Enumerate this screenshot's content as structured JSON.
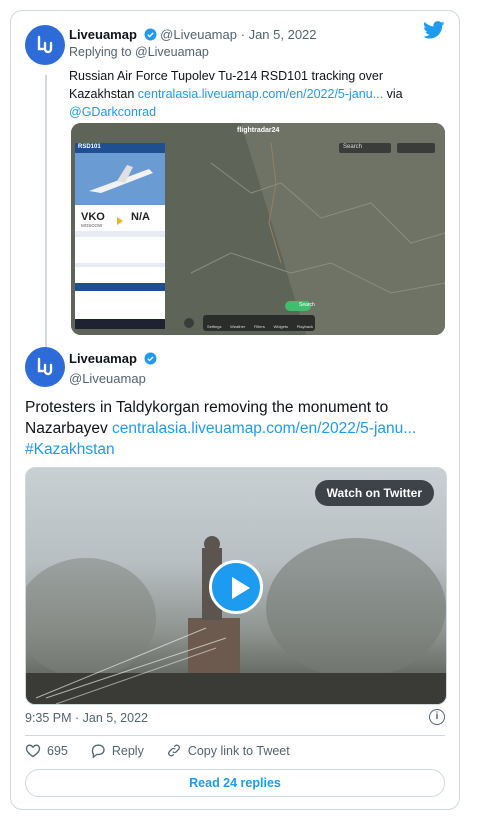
{
  "quoted": {
    "name": "Liveuamap",
    "handle": "@Liveuamap",
    "date": "Jan 5, 2022",
    "separator": "·",
    "replying_prefix": "Replying to ",
    "replying_handle": "@Liveuamap",
    "text_1": "Russian Air Force Tupolev Tu-214 RSD101 tracking over Kazakhstan ",
    "link": "centralasia.liveuamap.com/en/2022/5-janu...",
    "text_2": " via ",
    "mention": "@GDarkconrad",
    "map": {
      "brand": "flightradar24",
      "flight": "RSD101",
      "origin": "VKO",
      "destination": "N/A",
      "origin_city": "MOSCOW",
      "search": "Search",
      "action_label": "Search",
      "tabs": [
        "Settings",
        "Weather",
        "Filters",
        "Widgets",
        "Playback"
      ]
    }
  },
  "tweet": {
    "name": "Liveuamap",
    "handle": "@Liveuamap",
    "text": "Protesters in Taldykorgan removing the monument to Nazarbayev ",
    "link": "centralasia.liveuamap.com/en/2022/5-janu...",
    "hashtag": "#Kazakhstan",
    "video_button": "Watch on Twitter",
    "timestamp": "9:35 PM · Jan 5, 2022",
    "likes": "695",
    "reply_label": "Reply",
    "copy_label": "Copy link to Tweet",
    "read_replies": "Read 24 replies"
  },
  "colors": {
    "accent": "#1d9bf0",
    "avatar": "#2c6bd8",
    "border": "#cfd9de",
    "muted": "#536471"
  },
  "icons": [
    "twitter-bird-icon",
    "verified-badge-icon",
    "heart-icon",
    "reply-bubble-icon",
    "link-icon",
    "info-icon",
    "play-icon"
  ]
}
